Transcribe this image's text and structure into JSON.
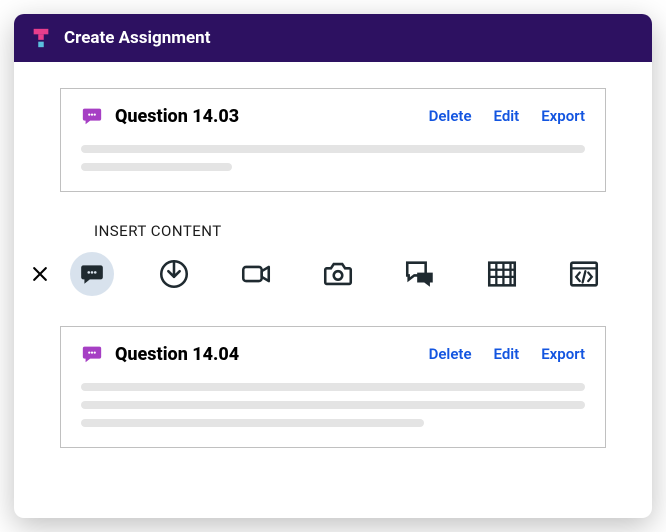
{
  "header": {
    "title": "Create Assignment"
  },
  "questions": [
    {
      "title": "Question 14.03"
    },
    {
      "title": "Question 14.04"
    }
  ],
  "actionLabels": {
    "delete": "Delete",
    "edit": "Edit",
    "export": "Export"
  },
  "insert": {
    "label": "INSERT CONTENT",
    "tools": [
      {
        "name": "chat"
      },
      {
        "name": "download"
      },
      {
        "name": "video"
      },
      {
        "name": "camera"
      },
      {
        "name": "discussion"
      },
      {
        "name": "table"
      },
      {
        "name": "code"
      }
    ]
  }
}
